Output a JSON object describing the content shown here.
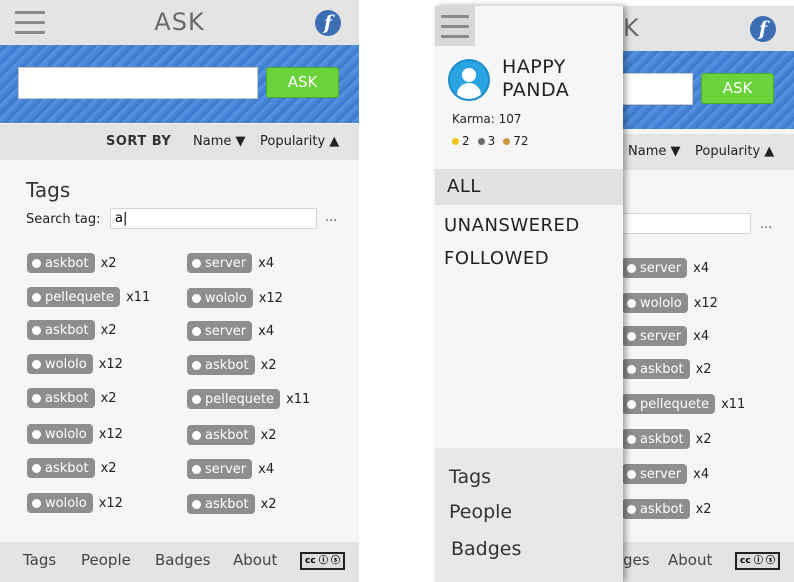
{
  "app": {
    "title": "ASK",
    "logo_glyph": "f"
  },
  "ask": {
    "button_label": "ASK",
    "input_value": ""
  },
  "sort": {
    "label": "SORT BY",
    "name": "Name ▼",
    "popularity": "Popularity ▲"
  },
  "tags_heading": "Tags",
  "search": {
    "label": "Search tag:",
    "value": "a|",
    "more": "..."
  },
  "tags_left": [
    {
      "name": "askbot",
      "count": "x2"
    },
    {
      "name": "pellequete",
      "count": "x11"
    },
    {
      "name": "askbot",
      "count": "x2"
    },
    {
      "name": "wololo",
      "count": "x12"
    },
    {
      "name": "askbot",
      "count": "x2"
    },
    {
      "name": "wololo",
      "count": "x12"
    },
    {
      "name": "askbot",
      "count": "x2"
    },
    {
      "name": "wololo",
      "count": "x12"
    }
  ],
  "tags_right": [
    {
      "name": "server",
      "count": "x4"
    },
    {
      "name": "wololo",
      "count": "x12"
    },
    {
      "name": "server",
      "count": "x4"
    },
    {
      "name": "askbot",
      "count": "x2"
    },
    {
      "name": "pellequete",
      "count": "x11"
    },
    {
      "name": "askbot",
      "count": "x2"
    },
    {
      "name": "server",
      "count": "x4"
    },
    {
      "name": "askbot",
      "count": "x2"
    }
  ],
  "footer": {
    "tags": "Tags",
    "people": "People",
    "badges": "Badges",
    "about": "About",
    "license": "cc ⓘ ⓢ",
    "badges_partial": "ges"
  },
  "drawer": {
    "user_name": "HAPPY PANDA",
    "karma": "Karma: 107",
    "badge_gold": "2",
    "badge_silver": "3",
    "badge_bronze": "72",
    "filters": {
      "all": "ALL",
      "unanswered": "UNANSWERED",
      "followed": "FOLLOWED"
    },
    "links": {
      "tags": "Tags",
      "people": "People",
      "badges": "Badges"
    }
  },
  "colors": {
    "ask_button": "#6ad23a",
    "band": "#4a86d8",
    "chip": "#8e8e8e",
    "avatar": "#2aa4e3",
    "gold": "#f2c418",
    "silver": "#6b6b6b",
    "bronze": "#c8973e"
  }
}
